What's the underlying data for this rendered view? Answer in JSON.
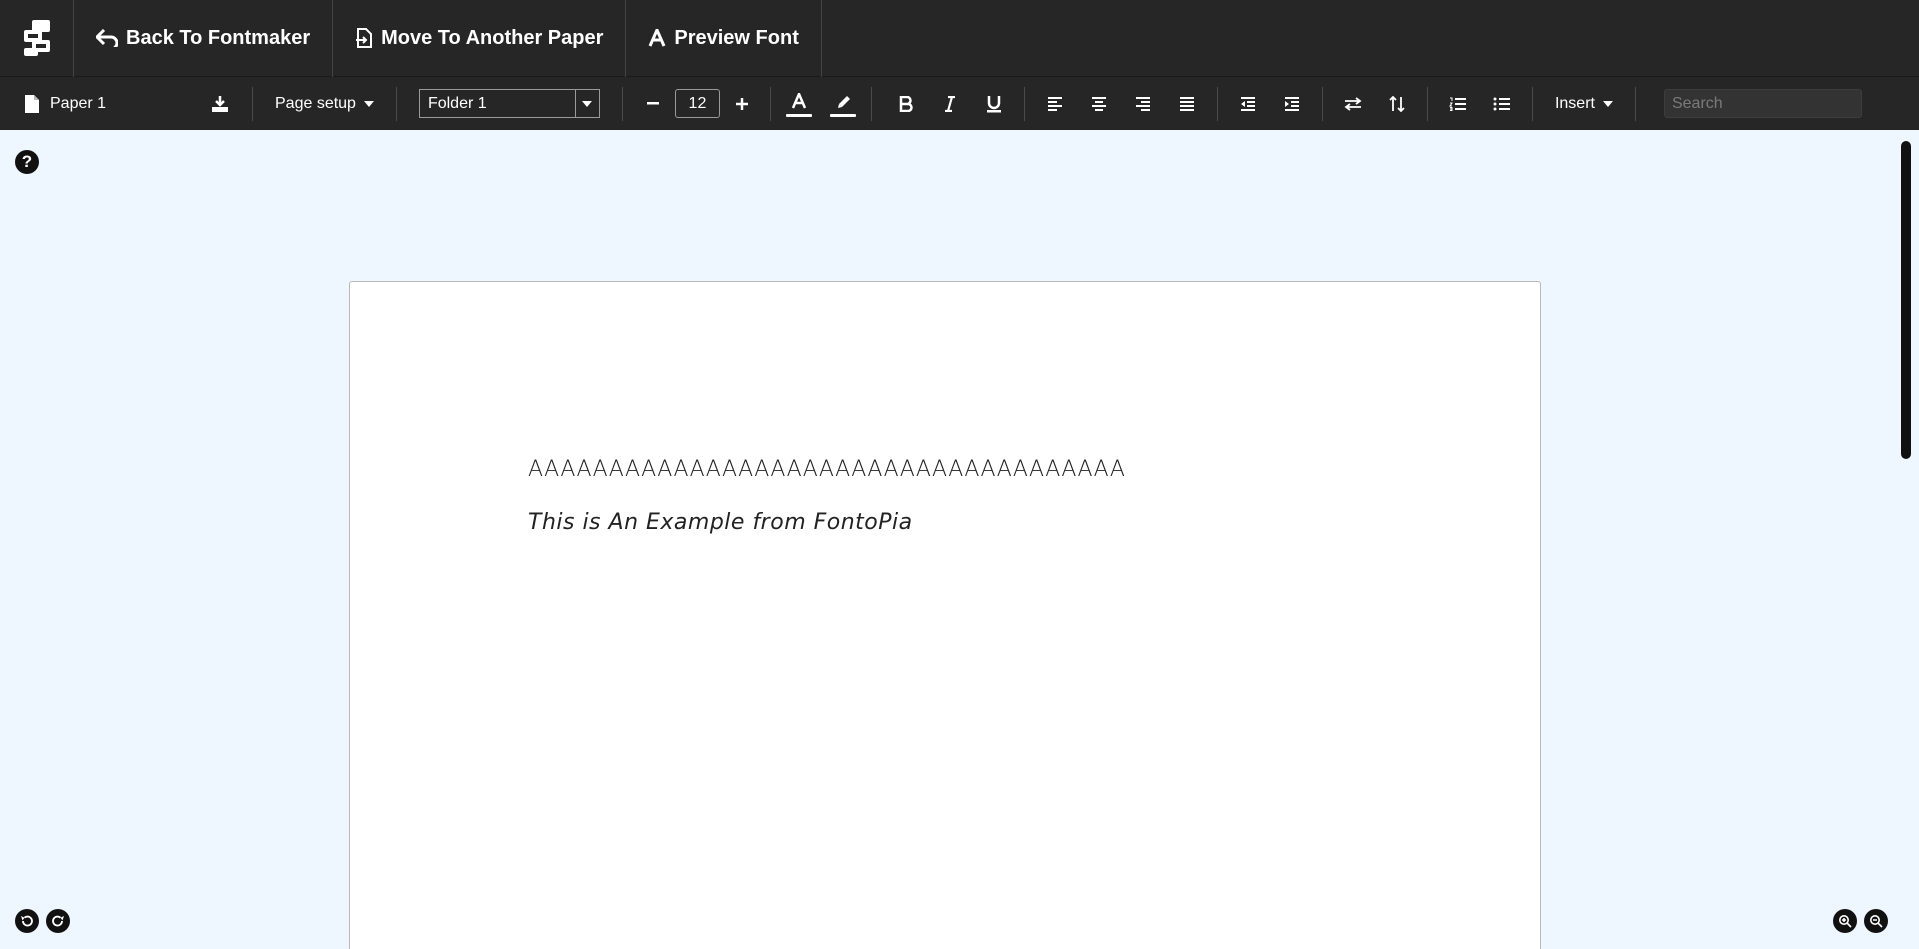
{
  "topbar": {
    "back_label": "Back To Fontmaker",
    "move_label": "Move To Another Paper",
    "preview_label": "Preview Font"
  },
  "toolbar": {
    "paper_name": "Paper 1",
    "page_setup_label": "Page setup",
    "folder_value": "Folder 1",
    "font_size": "12",
    "insert_label": "Insert",
    "search_placeholder": "Search"
  },
  "document": {
    "line1": "AAAAAAAAAAAAAAAAAAAAAAAAAAAAAAAAAAAAA",
    "line2": "This is An Example from FontoPia"
  },
  "help_label": "?"
}
